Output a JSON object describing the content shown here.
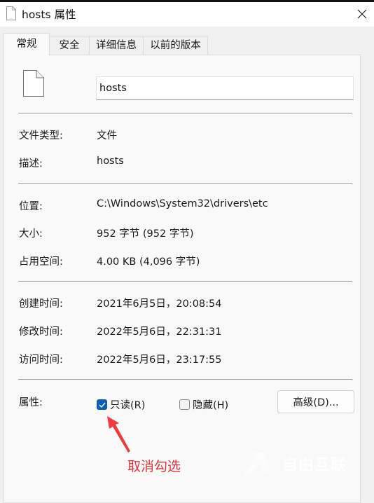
{
  "window": {
    "title": "hosts 属性",
    "title_icon": "document-icon",
    "close_icon": "close-icon"
  },
  "tabs": [
    {
      "label": "常规",
      "active": true
    },
    {
      "label": "安全",
      "active": false
    },
    {
      "label": "详细信息",
      "active": false
    },
    {
      "label": "以前的版本",
      "active": false
    }
  ],
  "general": {
    "file_icon": "document-icon",
    "name_value": "hosts",
    "rows": {
      "file_type": {
        "label": "文件类型:",
        "value": "文件"
      },
      "description": {
        "label": "描述:",
        "value": "hosts"
      },
      "location": {
        "label": "位置:",
        "value": "C:\\Windows\\System32\\drivers\\etc"
      },
      "size": {
        "label": "大小:",
        "value": "952 字节 (952 字节)"
      },
      "size_on_disk": {
        "label": "占用空间:",
        "value": "4.00 KB (4,096 字节)"
      },
      "created": {
        "label": "创建时间:",
        "value": "2021年6月5日，20:08:54"
      },
      "modified": {
        "label": "修改时间:",
        "value": "2022年5月6日，22:31:31"
      },
      "accessed": {
        "label": "访问时间:",
        "value": "2022年5月6日，23:17:55"
      }
    },
    "attributes": {
      "label": "属性:",
      "readonly": {
        "label": "只读(R)",
        "checked": true
      },
      "hidden": {
        "label": "隐藏(H)",
        "checked": false
      },
      "advanced_button": "高级(D)..."
    }
  },
  "annotation": {
    "text": "取消勾选",
    "color": "#e0333a",
    "arrow_icon": "arrow-up-left-icon"
  },
  "watermark": {
    "text": "自由互联"
  },
  "colors": {
    "accent": "#0f5cb8",
    "panel_bg": "#f9f9f9",
    "window_bg": "#f0f0f0"
  }
}
